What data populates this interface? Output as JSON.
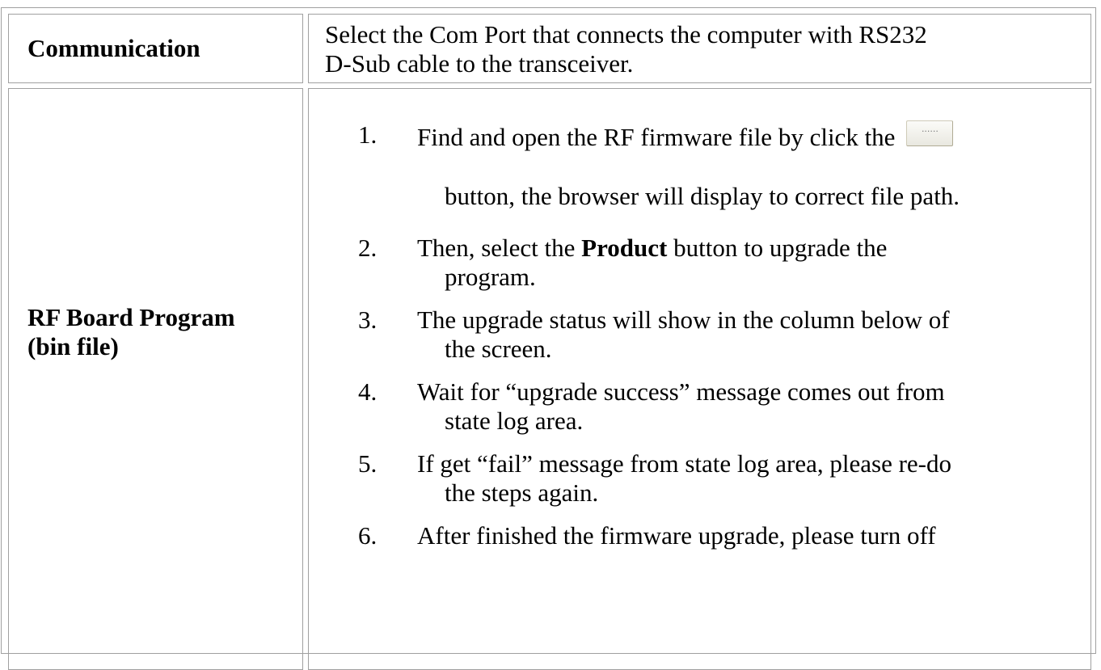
{
  "rows": [
    {
      "label": "Communication",
      "description_line1": "Select the Com Port that connects the computer with RS232",
      "description_line2": "D-Sub cable to the transceiver."
    },
    {
      "label_line1": "RF Board Program",
      "label_line2": "(bin file)",
      "steps": [
        {
          "num": "1.",
          "text": "Find and open the RF firmware file by click the",
          "button_label": "......",
          "cont": "button, the browser will display to correct file path."
        },
        {
          "num": "2.",
          "text_before": "Then, select the ",
          "text_bold": "Product",
          "text_after": " button to upgrade the",
          "cont": "program."
        },
        {
          "num": "3.",
          "text": "The upgrade status will show in the column below of",
          "cont": "the screen."
        },
        {
          "num": "4.",
          "text": "Wait for “upgrade success” message comes out from",
          "cont": "state log area."
        },
        {
          "num": "5.",
          "text": "If get “fail” message from state log area, please re-do",
          "cont": "the steps again."
        },
        {
          "num": "6.",
          "text": "After finished the firmware upgrade, please turn off"
        }
      ]
    }
  ]
}
